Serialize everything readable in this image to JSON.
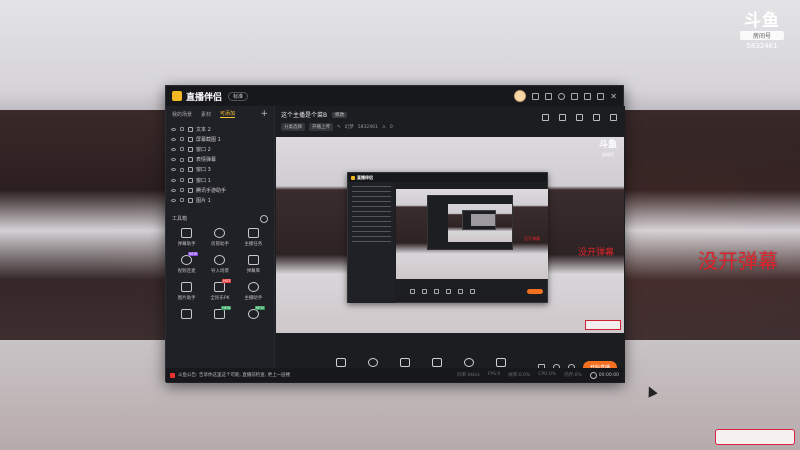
{
  "background": {
    "watermark_logo": "斗鱼",
    "watermark_sub": "房间号",
    "room_id": "5832461",
    "danmu_overlay": "没开弹幕"
  },
  "app": {
    "name": "直播伴侣",
    "version_badge": "标准",
    "sidebar": {
      "tabs": [
        "我的场景",
        "素材",
        "可添加"
      ],
      "active_tab": 2,
      "add_icon": "+",
      "scenes": [
        {
          "label": "文本 2",
          "icon": "text-icon"
        },
        {
          "label": "屏幕截图 1",
          "icon": "screenshot-icon"
        },
        {
          "label": "窗口 2",
          "icon": "window-icon"
        },
        {
          "label": "表情弹幕",
          "icon": "emoji-icon"
        },
        {
          "label": "窗口 3",
          "icon": "window-icon"
        },
        {
          "label": "窗口 1",
          "icon": "window-icon"
        },
        {
          "label": "腾讯手游助手",
          "icon": "game-icon"
        },
        {
          "label": "图片 1",
          "icon": "image-icon"
        }
      ],
      "toolbox_title": "工具箱",
      "tools": [
        {
          "label": "弹幕助手",
          "tag": ""
        },
        {
          "label": "房管助手",
          "tag": ""
        },
        {
          "label": "主播任务",
          "tag": ""
        },
        {
          "label": "视频连麦",
          "tag": "NEW"
        },
        {
          "label": "导入场景",
          "tag": ""
        },
        {
          "label": "弹幕库",
          "tag": ""
        },
        {
          "label": "图片助手",
          "tag": ""
        },
        {
          "label": "全民乐PK",
          "tag": "HOT"
        },
        {
          "label": "主播助手",
          "tag": ""
        },
        {
          "label": "",
          "tag": ""
        },
        {
          "label": "",
          "tag": "NEW"
        },
        {
          "label": "",
          "tag": "NEW"
        }
      ]
    },
    "main": {
      "stream_title": "这个主播是个菜B",
      "edit_badge": "修改",
      "chips": [
        "分类选择",
        "开播上传"
      ],
      "meta_text": "幻梦",
      "meta_id": "5832461",
      "meta_count": "0",
      "preview": {
        "watermark_logo": "斗鱼",
        "watermark_sub": "房间号",
        "danmu_overlay": "没开弹幕"
      },
      "bottom_tools": [
        {
          "label": "直播屏幕",
          "icon": "screen-icon"
        },
        {
          "label": "摄像头",
          "icon": "camera-icon"
        },
        {
          "label": "手机投屏",
          "icon": "phone-cast-icon"
        },
        {
          "label": "多媒体",
          "icon": "media-icon"
        },
        {
          "label": "麦克风",
          "icon": "mic-icon"
        },
        {
          "label": "扬声器",
          "icon": "speaker-icon"
        }
      ],
      "go_live_label": "开始直播"
    },
    "statusbar": {
      "notice": "斗鱼公告: 告诉你这里这个可能, 直播前检查, 更上一层楼",
      "stats": [
        "码率:0kb/s",
        "FPS:0",
        "帧率:0.0%",
        "CPU:0%",
        "内存:0%"
      ],
      "timer": "00:00:00"
    }
  }
}
